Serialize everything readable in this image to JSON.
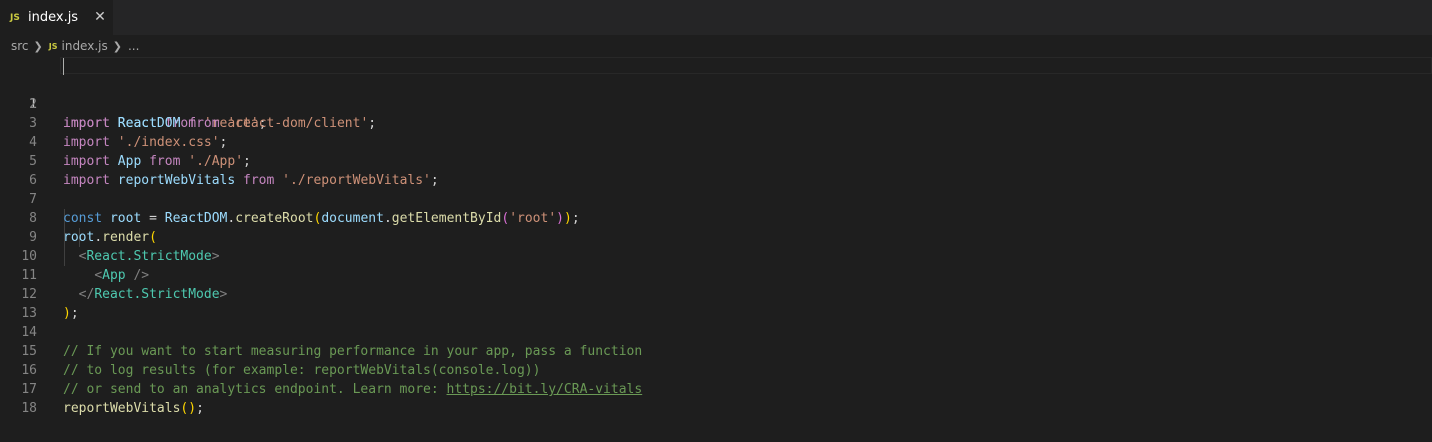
{
  "tab": {
    "badge": "JS",
    "title": "index.js",
    "close": "✕"
  },
  "breadcrumb": {
    "folder": "src",
    "file_badge": "JS",
    "file": "index.js",
    "more": "..."
  },
  "line_numbers": [
    "1",
    "2",
    "3",
    "4",
    "5",
    "6",
    "7",
    "8",
    "9",
    "10",
    "11",
    "12",
    "13",
    "14",
    "15",
    "16",
    "17",
    "18"
  ],
  "code": {
    "kw_import": "import",
    "kw_from": "from",
    "kw_const": "const",
    "l1": {
      "id": "React",
      "src": "'react'",
      "end": ";"
    },
    "l2": {
      "id": "ReactDOM",
      "src": "'react-dom/client'",
      "end": ";"
    },
    "l3": {
      "src": "'./index.css'",
      "end": ";"
    },
    "l4": {
      "id": "App",
      "src": "'./App'",
      "end": ";"
    },
    "l5": {
      "id": "reportWebVitals",
      "src": "'./reportWebVitals'",
      "end": ";"
    },
    "l7": {
      "name": "root",
      "eq": " = ",
      "obj": "ReactDOM",
      "dot": ".",
      "method": "createRoot",
      "po": "(",
      "arg_obj": "document",
      "dot2": ".",
      "arg_method": "getElementById",
      "pi": "(",
      "arg": "'root'",
      "pic": ")",
      "poc": ")",
      "end": ";"
    },
    "l8": {
      "obj": "root",
      "dot": ".",
      "method": "render",
      "po": "("
    },
    "l9": {
      "open": "<",
      "tag": "React.StrictMode",
      "close": ">"
    },
    "l10": {
      "open": "<",
      "tag": "App",
      "close": " />"
    },
    "l11": {
      "open": "</",
      "tag": "React.StrictMode",
      "close": ">"
    },
    "l12": {
      "pc": ")",
      "end": ";"
    },
    "l14": "// If you want to start measuring performance in your app, pass a function",
    "l15": "// to log results (for example: reportWebVitals(console.log))",
    "l16_prefix": "// or send to an analytics endpoint. Learn more: ",
    "l16_link": "https://bit.ly/CRA-vitals",
    "l17": {
      "fn": "reportWebVitals",
      "po": "(",
      "pc": ")",
      "end": ";"
    }
  },
  "colors": {
    "background": "#1e1e1e",
    "keyword": "#c586c0",
    "variable": "#9cdcfe",
    "string": "#ce9178",
    "storage": "#569cd6",
    "function": "#dcdcaa",
    "jsx_tag": "#4ec9b0",
    "comment": "#6a9955",
    "js_badge": "#cbcb41"
  }
}
